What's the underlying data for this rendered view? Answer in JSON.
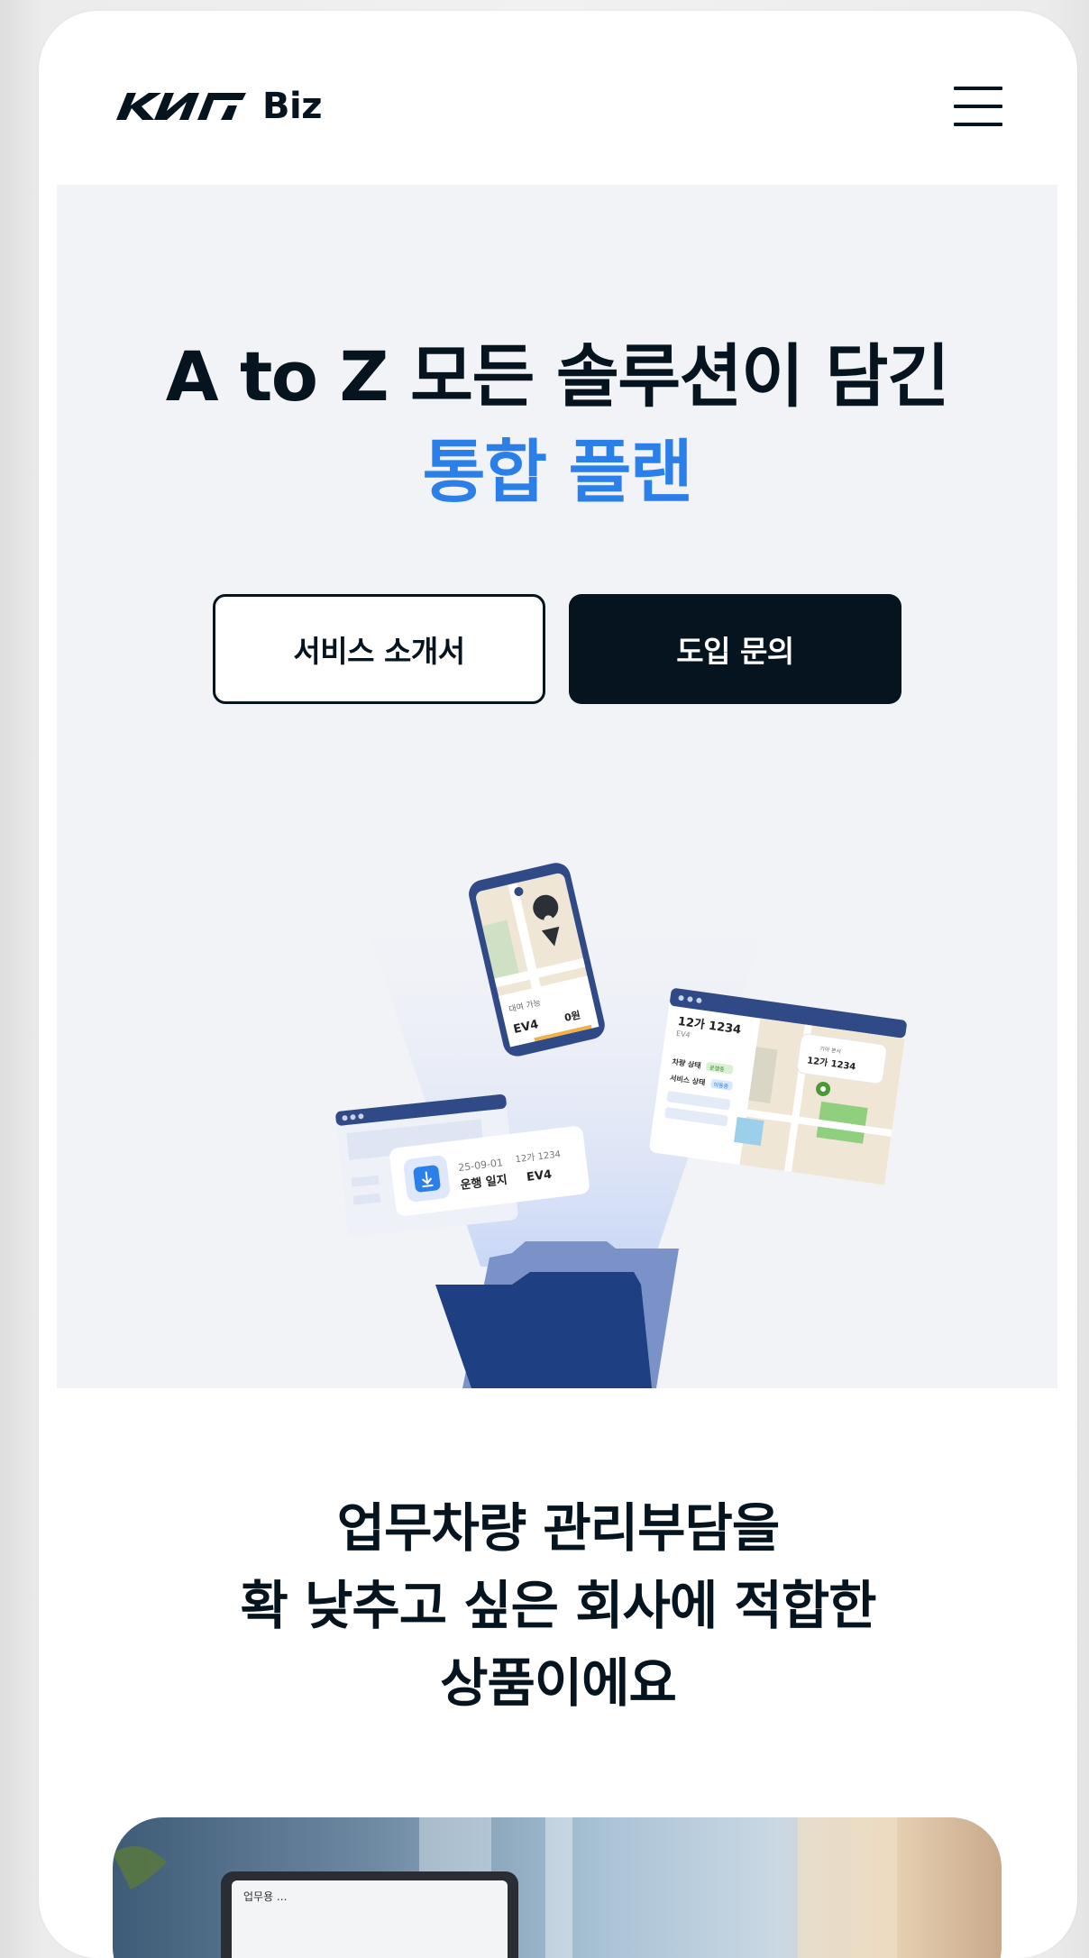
{
  "header": {
    "logo_text": "Biz",
    "brand_logo": "kia-logo",
    "menu_icon": "hamburger-menu-icon"
  },
  "hero": {
    "title_line1": "A to Z 모든 솔루션이 담긴",
    "title_line2": "통합 플랜",
    "button_brochure": "서비스 소개서",
    "button_inquiry": "도입 문의",
    "accent_color": "#2b7fe9",
    "dark_color": "#05141f",
    "illustration": {
      "phone_status": "대여 가능",
      "phone_model": "EV4",
      "phone_price": "0원",
      "log_date": "25-09-01",
      "log_plate": "12가 1234",
      "log_title": "운행 일지",
      "log_model": "EV4",
      "dashboard_plate": "12가 1234",
      "dashboard_model": "EV4",
      "dashboard_row1_label": "차량 상태",
      "dashboard_row1_badge": "운행중",
      "dashboard_row2_label": "서비스 상태",
      "dashboard_row2_badge": "이용중",
      "dashboard_popup_small": "기아 본사",
      "dashboard_popup_plate": "12가 1234"
    }
  },
  "section2": {
    "line1": "업무차량 관리부담을",
    "line2": "확 낮추고 싶은 회사에 적합한",
    "line3": "상품이에요"
  },
  "photo": {
    "screen_text": "업무용 ..."
  }
}
